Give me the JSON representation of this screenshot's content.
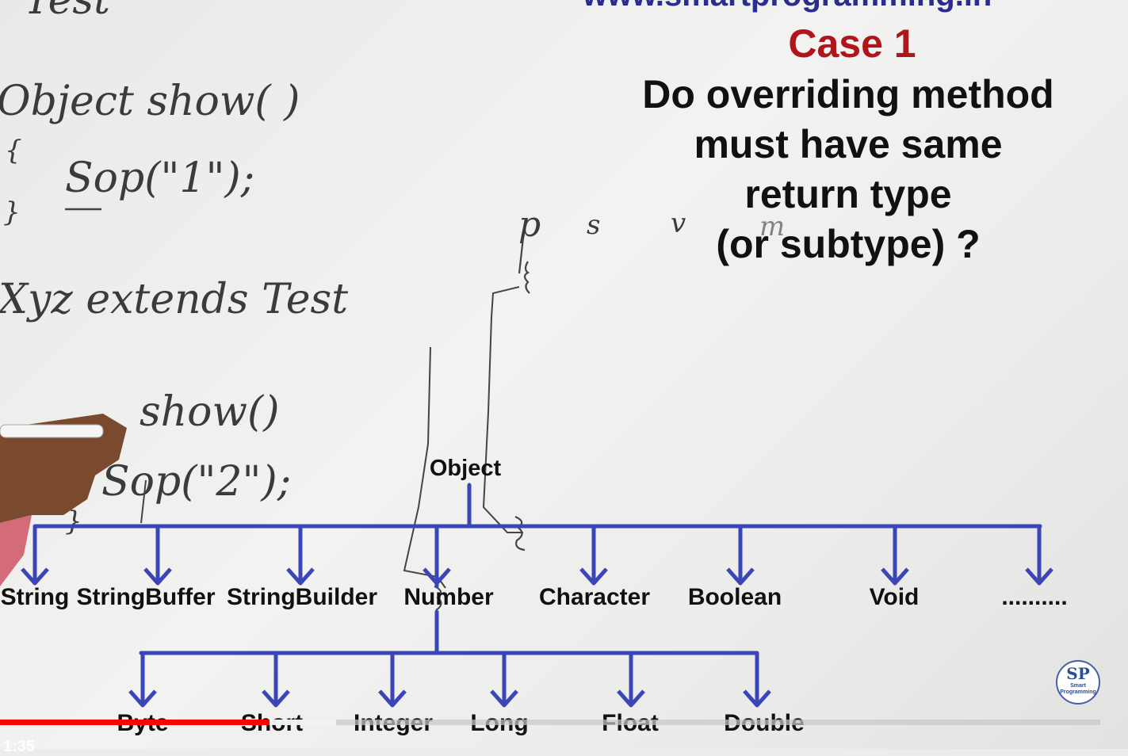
{
  "header": {
    "url_text": "www.smartprogramming.in",
    "case_title": "Case 1",
    "question_lines": [
      "Do overriding method",
      "must have same",
      "return type",
      "(or subtype) ?"
    ]
  },
  "handwriting": {
    "class_line": "Test",
    "method_line": "Object show( )",
    "open_brace_1": "{",
    "sop_1": "Sop(\"1\");",
    "close_brace_1": "}",
    "subclass_line": "Xyz extends Test",
    "method_line_2": "show()",
    "sop_2": "Sop(\"2\");",
    "close_brace_2": "}",
    "main_signature": [
      "p",
      "s",
      "v",
      "m",
      "(",
      ")"
    ]
  },
  "diagram": {
    "root": "Object",
    "level1": [
      "String",
      "StringBuffer",
      "StringBuilder",
      "Number",
      "Character",
      "Boolean",
      "Void",
      ".........."
    ],
    "level2_parent": "Number",
    "level2": [
      "Byte",
      "Short",
      "Integer",
      "Long",
      "Float",
      "Double"
    ],
    "line_color": "#3a45b8"
  },
  "player": {
    "progress_fraction": 0.245,
    "time": "1:35"
  },
  "logo": {
    "monogram": "SP",
    "text_lines": [
      "Smart",
      "Programming"
    ]
  }
}
